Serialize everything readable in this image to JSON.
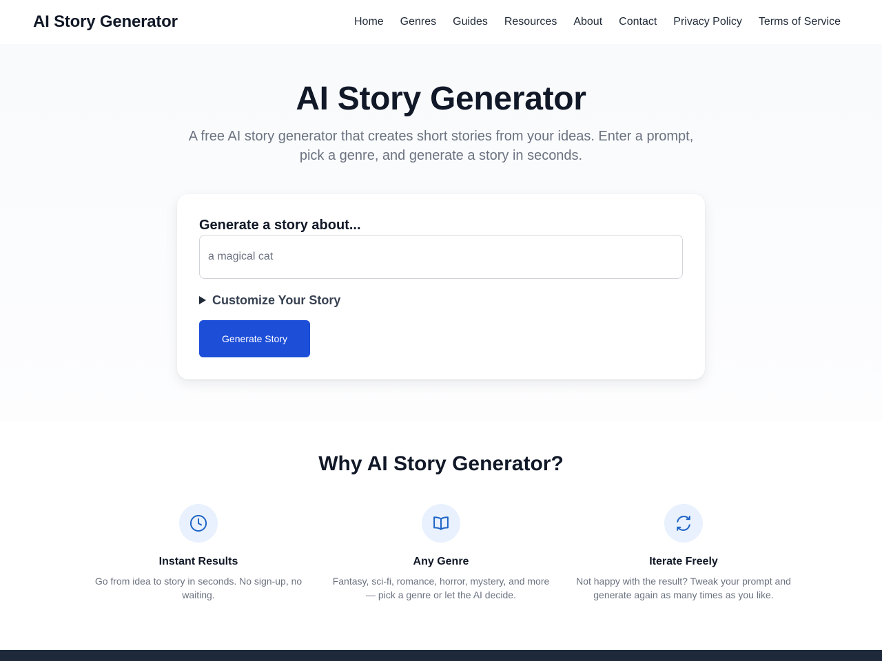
{
  "header": {
    "brand": "AI Story Generator",
    "nav": [
      "Home",
      "Genres",
      "Guides",
      "Resources",
      "About",
      "Contact",
      "Privacy Policy",
      "Terms of Service"
    ]
  },
  "hero": {
    "title": "AI Story Generator",
    "subtitle": "A free AI story generator that creates short stories from your ideas. Enter a prompt, pick a genre, and generate a story in seconds."
  },
  "generator": {
    "label": "Generate a story about...",
    "input_value": "",
    "input_placeholder": "a magical cat",
    "customize_label": "Customize Your Story",
    "customize_icon": "triangle-right-icon",
    "button_label": "Generate Story"
  },
  "features": {
    "title": "Why AI Story Generator?",
    "items": [
      {
        "icon": "clock-icon",
        "title": "Instant Results",
        "desc": "Go from idea to story in seconds. No sign-up, no waiting."
      },
      {
        "icon": "book-open-icon",
        "title": "Any Genre",
        "desc": "Fantasy, sci-fi, romance, horror, mystery, and more — pick a genre or let the AI decide."
      },
      {
        "icon": "refresh-icon",
        "title": "Iterate Freely",
        "desc": "Not happy with the result? Tweak your prompt and generate again as many times as you like."
      }
    ]
  },
  "colors": {
    "accent": "#1d4ed8",
    "icon_stroke": "#1e63c6",
    "icon_bg": "#e8f1fd",
    "footer": "#1e293b"
  }
}
